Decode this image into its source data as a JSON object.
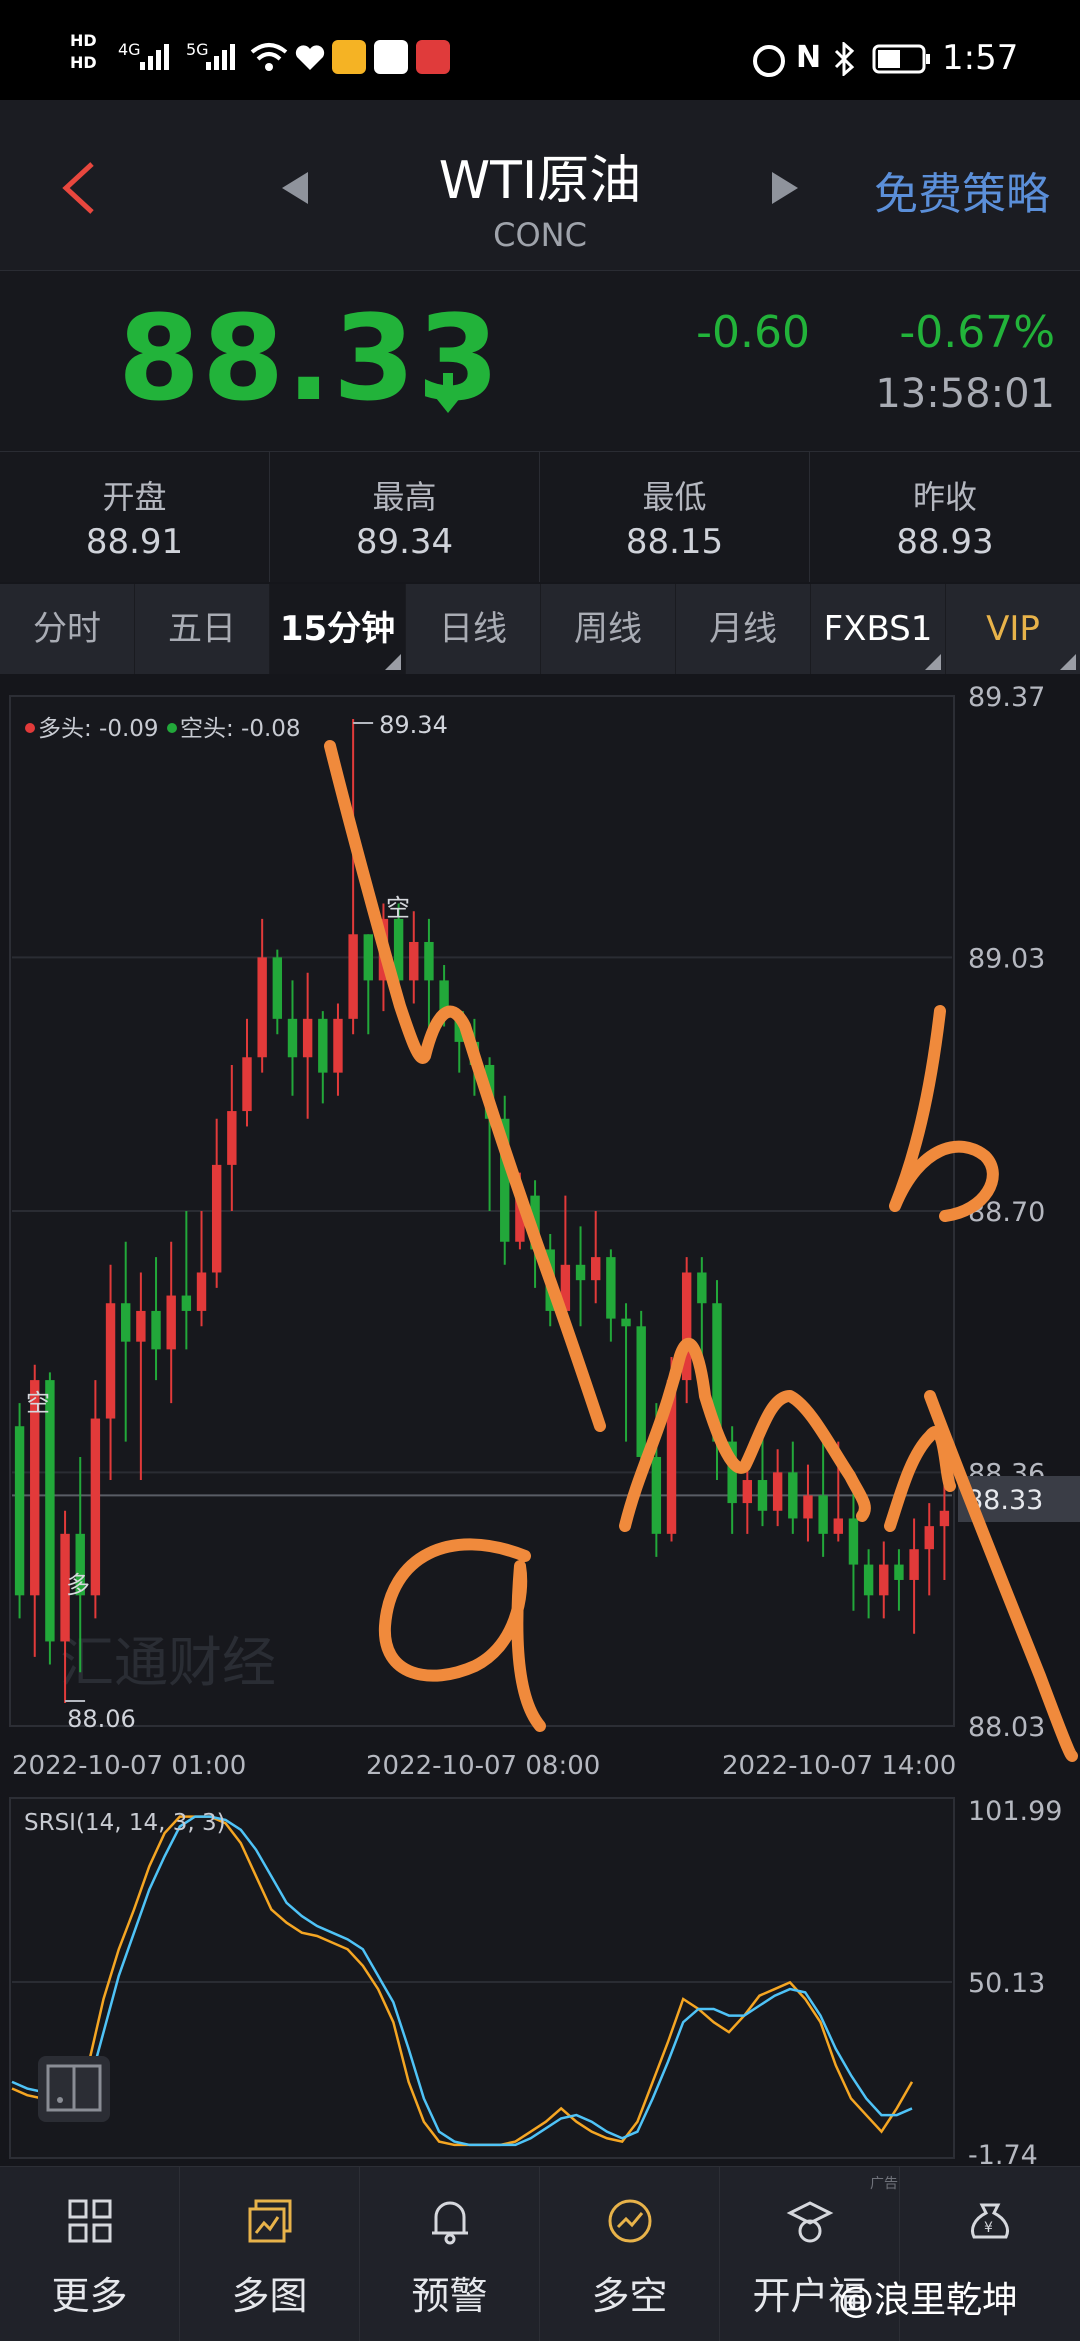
{
  "status_bar": {
    "hd1": "HD",
    "hd2": "HD",
    "sig1": "4G",
    "sig2": "5G",
    "nfc": "N",
    "time": "1:57"
  },
  "header": {
    "title": "WTI原油",
    "subtitle": "CONC",
    "strategy_label": "免费策略"
  },
  "quote": {
    "price": "88.33",
    "change": "-0.60",
    "change_pct": "-0.67%",
    "time": "13:58:01"
  },
  "ohlc": [
    {
      "label": "开盘",
      "value": "88.91"
    },
    {
      "label": "最高",
      "value": "89.34"
    },
    {
      "label": "最低",
      "value": "88.15"
    },
    {
      "label": "昨收",
      "value": "88.93"
    }
  ],
  "tabs": [
    {
      "label": "分时"
    },
    {
      "label": "五日"
    },
    {
      "label": "15分钟"
    },
    {
      "label": "日线"
    },
    {
      "label": "周线"
    },
    {
      "label": "月线"
    },
    {
      "label": "FXBS1"
    },
    {
      "label": "VIP"
    }
  ],
  "chart_data": [
    {
      "type": "candlestick",
      "legend": {
        "long_label": "多头: -0.09",
        "short_label": "空头: -0.08"
      },
      "ylim": [
        88.03,
        89.37
      ],
      "y_ticks": [
        "89.37",
        "89.03",
        "88.70",
        "88.36",
        "88.03"
      ],
      "x_ticks": [
        "2022-10-07 01:00",
        "2022-10-07 08:00",
        "2022-10-07 14:00"
      ],
      "current_price": "88.33",
      "high_label": "89.34",
      "low_label": "88.06",
      "annotations": [
        {
          "text": "空"
        },
        {
          "text": "空"
        },
        {
          "text": "多"
        }
      ],
      "watermark": "汇通财经",
      "candles": [
        [
          88.42,
          88.2,
          88.45,
          88.17
        ],
        [
          88.2,
          88.48,
          88.5,
          88.12
        ],
        [
          88.48,
          88.14,
          88.49,
          88.11
        ],
        [
          88.14,
          88.28,
          88.31,
          88.06
        ],
        [
          88.28,
          88.2,
          88.38,
          88.1
        ],
        [
          88.2,
          88.43,
          88.48,
          88.17
        ],
        [
          88.43,
          88.58,
          88.63,
          88.35
        ],
        [
          88.58,
          88.53,
          88.66,
          88.4
        ],
        [
          88.53,
          88.57,
          88.62,
          88.35
        ],
        [
          88.57,
          88.52,
          88.64,
          88.48
        ],
        [
          88.52,
          88.59,
          88.66,
          88.45
        ],
        [
          88.59,
          88.57,
          88.7,
          88.52
        ],
        [
          88.57,
          88.62,
          88.7,
          88.55
        ],
        [
          88.62,
          88.76,
          88.82,
          88.6
        ],
        [
          88.76,
          88.83,
          88.89,
          88.7
        ],
        [
          88.83,
          88.9,
          88.95,
          88.81
        ],
        [
          88.9,
          89.03,
          89.08,
          88.88
        ],
        [
          89.03,
          88.95,
          89.04,
          88.93
        ],
        [
          88.95,
          88.9,
          89.0,
          88.85
        ],
        [
          88.9,
          88.95,
          89.01,
          88.82
        ],
        [
          88.95,
          88.88,
          88.96,
          88.84
        ],
        [
          88.88,
          88.95,
          88.97,
          88.85
        ],
        [
          88.95,
          89.06,
          89.34,
          88.93
        ],
        [
          89.06,
          89.0,
          89.06,
          88.93
        ],
        [
          89.0,
          89.08,
          89.1,
          88.96
        ],
        [
          89.08,
          89.0,
          89.1,
          88.97
        ],
        [
          89.0,
          89.05,
          89.09,
          88.97
        ],
        [
          89.05,
          89.0,
          89.08,
          88.92
        ],
        [
          89.0,
          88.96,
          89.02,
          88.94
        ],
        [
          88.96,
          88.92,
          88.96,
          88.88
        ],
        [
          88.92,
          88.89,
          88.95,
          88.85
        ],
        [
          88.89,
          88.82,
          88.9,
          88.7
        ],
        [
          88.82,
          88.66,
          88.85,
          88.63
        ],
        [
          88.66,
          88.72,
          88.75,
          88.65
        ],
        [
          88.72,
          88.65,
          88.74,
          88.6
        ],
        [
          88.65,
          88.57,
          88.67,
          88.55
        ],
        [
          88.57,
          88.63,
          88.72,
          88.56
        ],
        [
          88.63,
          88.61,
          88.68,
          88.55
        ],
        [
          88.61,
          88.64,
          88.7,
          88.58
        ],
        [
          88.64,
          88.56,
          88.65,
          88.53
        ],
        [
          88.56,
          88.55,
          88.58,
          88.4
        ],
        [
          88.55,
          88.38,
          88.57,
          88.35
        ],
        [
          88.38,
          88.28,
          88.45,
          88.25
        ],
        [
          88.28,
          88.48,
          88.51,
          88.27
        ],
        [
          88.48,
          88.62,
          88.64,
          88.45
        ],
        [
          88.62,
          88.58,
          88.64,
          88.48
        ],
        [
          88.58,
          88.4,
          88.61,
          88.35
        ],
        [
          88.4,
          88.32,
          88.42,
          88.28
        ],
        [
          88.32,
          88.35,
          88.38,
          88.28
        ],
        [
          88.35,
          88.31,
          88.41,
          88.29
        ],
        [
          88.31,
          88.36,
          88.39,
          88.29
        ],
        [
          88.36,
          88.3,
          88.4,
          88.28
        ],
        [
          88.3,
          88.33,
          88.37,
          88.27
        ],
        [
          88.33,
          88.28,
          88.4,
          88.25
        ],
        [
          88.28,
          88.3,
          88.4,
          88.27
        ],
        [
          88.3,
          88.24,
          88.34,
          88.18
        ],
        [
          88.24,
          88.2,
          88.26,
          88.17
        ],
        [
          88.2,
          88.24,
          88.27,
          88.17
        ],
        [
          88.24,
          88.22,
          88.26,
          88.18
        ],
        [
          88.22,
          88.26,
          88.3,
          88.15
        ],
        [
          88.26,
          88.29,
          88.32,
          88.2
        ],
        [
          88.29,
          88.31,
          88.36,
          88.22
        ]
      ]
    },
    {
      "type": "line",
      "title": "SRSI(14, 14, 3, 3)",
      "ylim": [
        -1.74,
        101.99
      ],
      "y_ticks": [
        "101.99",
        "50.13",
        "-1.74"
      ],
      "series": [
        {
          "color": "#f5a623",
          "values": [
            18,
            16,
            15,
            14,
            13,
            25,
            45,
            60,
            72,
            85,
            95,
            100,
            100,
            100,
            98,
            92,
            82,
            72,
            68,
            65,
            64,
            62,
            60,
            55,
            48,
            38,
            20,
            8,
            2,
            1,
            1,
            1,
            1,
            2,
            5,
            8,
            12,
            8,
            5,
            3,
            2,
            8,
            20,
            32,
            45,
            42,
            38,
            35,
            40,
            46,
            48,
            50,
            45,
            38,
            25,
            15,
            10,
            5,
            12,
            20
          ]
        },
        {
          "color": "#4fc3f7",
          "values": [
            20,
            18,
            17,
            16,
            15,
            18,
            35,
            52,
            65,
            78,
            88,
            97,
            100,
            100,
            99,
            96,
            90,
            82,
            74,
            70,
            67,
            65,
            63,
            60,
            52,
            44,
            30,
            15,
            5,
            2,
            1,
            1,
            1,
            1,
            3,
            6,
            9,
            10,
            8,
            5,
            3,
            5,
            15,
            26,
            38,
            42,
            42,
            40,
            40,
            43,
            46,
            48,
            47,
            40,
            30,
            22,
            15,
            10,
            10,
            12
          ]
        }
      ]
    }
  ],
  "bottom_nav": [
    {
      "label": "更多",
      "icon": "grid-icon"
    },
    {
      "label": "多图",
      "icon": "multichart-icon"
    },
    {
      "label": "预警",
      "icon": "bell-icon"
    },
    {
      "label": "多空",
      "icon": "trend-circle-icon"
    },
    {
      "label": "开户福",
      "icon": "gift-hat-icon"
    },
    {
      "label": "",
      "icon": "money-bag-icon"
    }
  ],
  "overlay": {
    "weibo_credit": "@浪里乾坤",
    "ad_tag": "广告",
    "handwritten": [
      "a",
      "b"
    ]
  },
  "colors": {
    "up": "#e23a3a",
    "down": "#22a83a",
    "price_green": "#22b33a",
    "accent_blue": "#5b8fd9",
    "annotation": "#f08a3c"
  }
}
